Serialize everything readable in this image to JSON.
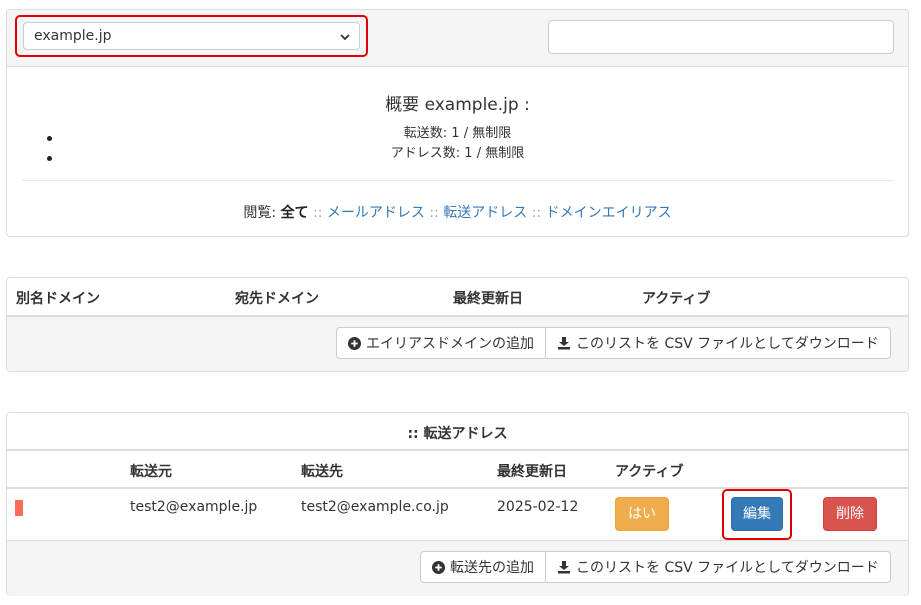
{
  "domain_select": {
    "value": "example.jp"
  },
  "search": {
    "value": ""
  },
  "overview": {
    "title": "概要 example.jp :",
    "stats": [
      "転送数: 1 / 無制限",
      "アドレス数: 1 / 無制限"
    ],
    "view": {
      "label": "閲覧:",
      "current": "全て",
      "sep": "::",
      "links": [
        "メールアドレス",
        "転送アドレス",
        "ドメインエイリアス"
      ]
    }
  },
  "alias_panel": {
    "headers": [
      "別名ドメイン",
      "宛先ドメイン",
      "最終更新日",
      "アクティブ"
    ],
    "buttons": [
      "エイリアスドメインの追加",
      "このリストを CSV ファイルとしてダウンロード"
    ]
  },
  "forward_panel": {
    "title": ":: 転送アドレス",
    "headers": [
      "転送元",
      "転送先",
      "最終更新日",
      "アクティブ"
    ],
    "rows": [
      {
        "from": "test2@example.jp",
        "to": "test2@example.co.jp",
        "updated": "2025-02-12",
        "active": "はい",
        "edit": "編集",
        "delete": "削除"
      }
    ],
    "buttons": [
      "転送先の追加",
      "このリストを CSV ファイルとしてダウンロード"
    ]
  },
  "colors": {
    "link": "#337ab7",
    "yes": "#f0ad4e",
    "edit": "#337ab7",
    "delete": "#d9534f",
    "status_mark": "#fa6d59",
    "highlight": "#e00000"
  },
  "icons": [
    "chevron-down-icon",
    "plus-circle-icon",
    "download-icon"
  ]
}
